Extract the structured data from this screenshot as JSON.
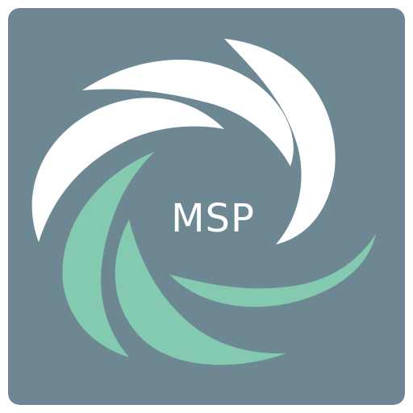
{
  "app_icon": {
    "label": "MSP",
    "colors": {
      "background": "#6E8893",
      "swirl_light": "#FFFFFF",
      "swirl_accent": "#83CAB1",
      "text": "#FFFFFF"
    },
    "icon_name": "swirl-logo-icon"
  }
}
